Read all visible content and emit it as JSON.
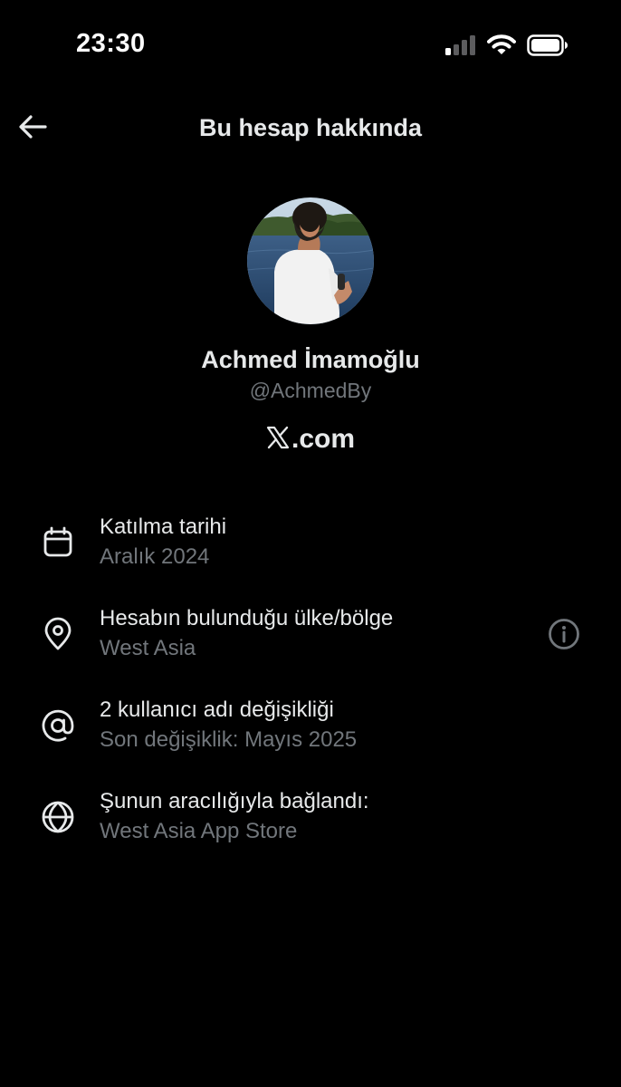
{
  "status_bar": {
    "time": "23:30",
    "icons": [
      "signal-icon",
      "wifi-icon",
      "battery-icon"
    ]
  },
  "header": {
    "back_icon": "arrow-left-icon",
    "title": "Bu hesap hakkında"
  },
  "profile": {
    "display_name": "Achmed İmamoğlu",
    "handle": "@AchmedBy",
    "platform_logo": "x-logo",
    "platform_suffix": ".com"
  },
  "info_items": [
    {
      "icon": "calendar-icon",
      "title": "Katılma tarihi",
      "subtitle": "Aralık 2024"
    },
    {
      "icon": "location-pin-icon",
      "title": "Hesabın bulunduğu ülke/bölge",
      "subtitle": "West Asia",
      "action_icon": "info-icon"
    },
    {
      "icon": "at-sign-icon",
      "title": "2 kullanıcı adı değişikliği",
      "subtitle": "Son değişiklik: Mayıs 2025"
    },
    {
      "icon": "globe-icon",
      "title": "Şunun aracılığıyla bağlandı:",
      "subtitle": "West Asia App Store"
    }
  ],
  "colors": {
    "background": "#000000",
    "primary_text": "#e7e9ea",
    "secondary_text": "#71767b"
  }
}
